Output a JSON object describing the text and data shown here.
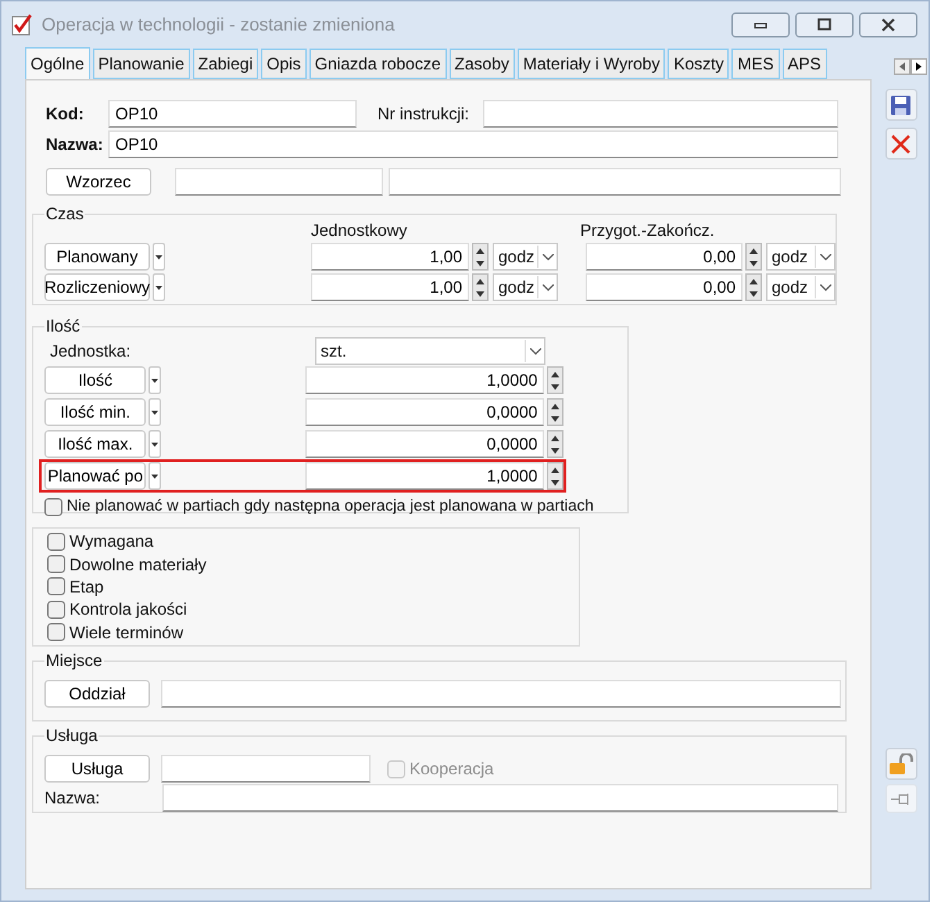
{
  "window": {
    "title": "Operacja w technologii - zostanie zmieniona"
  },
  "tabs": [
    {
      "label": "Ogólne",
      "selected": true
    },
    {
      "label": "Planowanie",
      "selected": false
    },
    {
      "label": "Zabiegi",
      "selected": false
    },
    {
      "label": "Opis",
      "selected": false
    },
    {
      "label": "Gniazda robocze",
      "selected": false
    },
    {
      "label": "Zasoby",
      "selected": false
    },
    {
      "label": "Materiały i Wyroby",
      "selected": false
    },
    {
      "label": "Koszty",
      "selected": false
    },
    {
      "label": "MES",
      "selected": false
    },
    {
      "label": "APS",
      "selected": false
    }
  ],
  "header": {
    "kod_label": "Kod:",
    "kod_value": "OP10",
    "nr_instrukcji_label": "Nr instrukcji:",
    "nazwa_label": "Nazwa:",
    "nazwa_value": "OP10",
    "wzorzec_button": "Wzorzec"
  },
  "czas": {
    "title": "Czas",
    "columns": [
      "Jednostkowy",
      "Przygot.-Zakończ."
    ],
    "rows": [
      {
        "button": "Planowany",
        "values": [
          {
            "value": "1,00",
            "unit": "godz"
          },
          {
            "value": "0,00",
            "unit": "godz"
          }
        ]
      },
      {
        "button": "Rozliczeniowy",
        "values": [
          {
            "value": "1,00",
            "unit": "godz"
          },
          {
            "value": "0,00",
            "unit": "godz"
          }
        ]
      }
    ]
  },
  "ilosc": {
    "title": "Ilość",
    "jednostka_label": "Jednostka:",
    "jednostka_value": "szt.",
    "rows": [
      {
        "button": "Ilość",
        "value": "1,0000",
        "highlighted": false
      },
      {
        "button": "Ilość min.",
        "value": "0,0000",
        "highlighted": false
      },
      {
        "button": "Ilość max.",
        "value": "0,0000",
        "highlighted": false
      },
      {
        "button": "Planować po",
        "value": "1,0000",
        "highlighted": true
      }
    ],
    "checkbox": {
      "label": "Nie planować w partiach gdy następna operacja jest planowana w partiach",
      "checked": false
    }
  },
  "flags": [
    {
      "label": "Wymagana",
      "checked": false
    },
    {
      "label": "Dowolne materiały",
      "checked": false
    },
    {
      "label": "Etap",
      "checked": false
    },
    {
      "label": "Kontrola jakości",
      "checked": false
    },
    {
      "label": "Wiele terminów",
      "checked": false
    }
  ],
  "miejsce": {
    "title": "Miejsce",
    "button": "Oddział"
  },
  "usluga": {
    "title": "Usługa",
    "button": "Usługa",
    "kooperacja": {
      "label": "Kooperacja",
      "checked": false,
      "disabled": true
    },
    "nazwa_label": "Nazwa:"
  }
}
